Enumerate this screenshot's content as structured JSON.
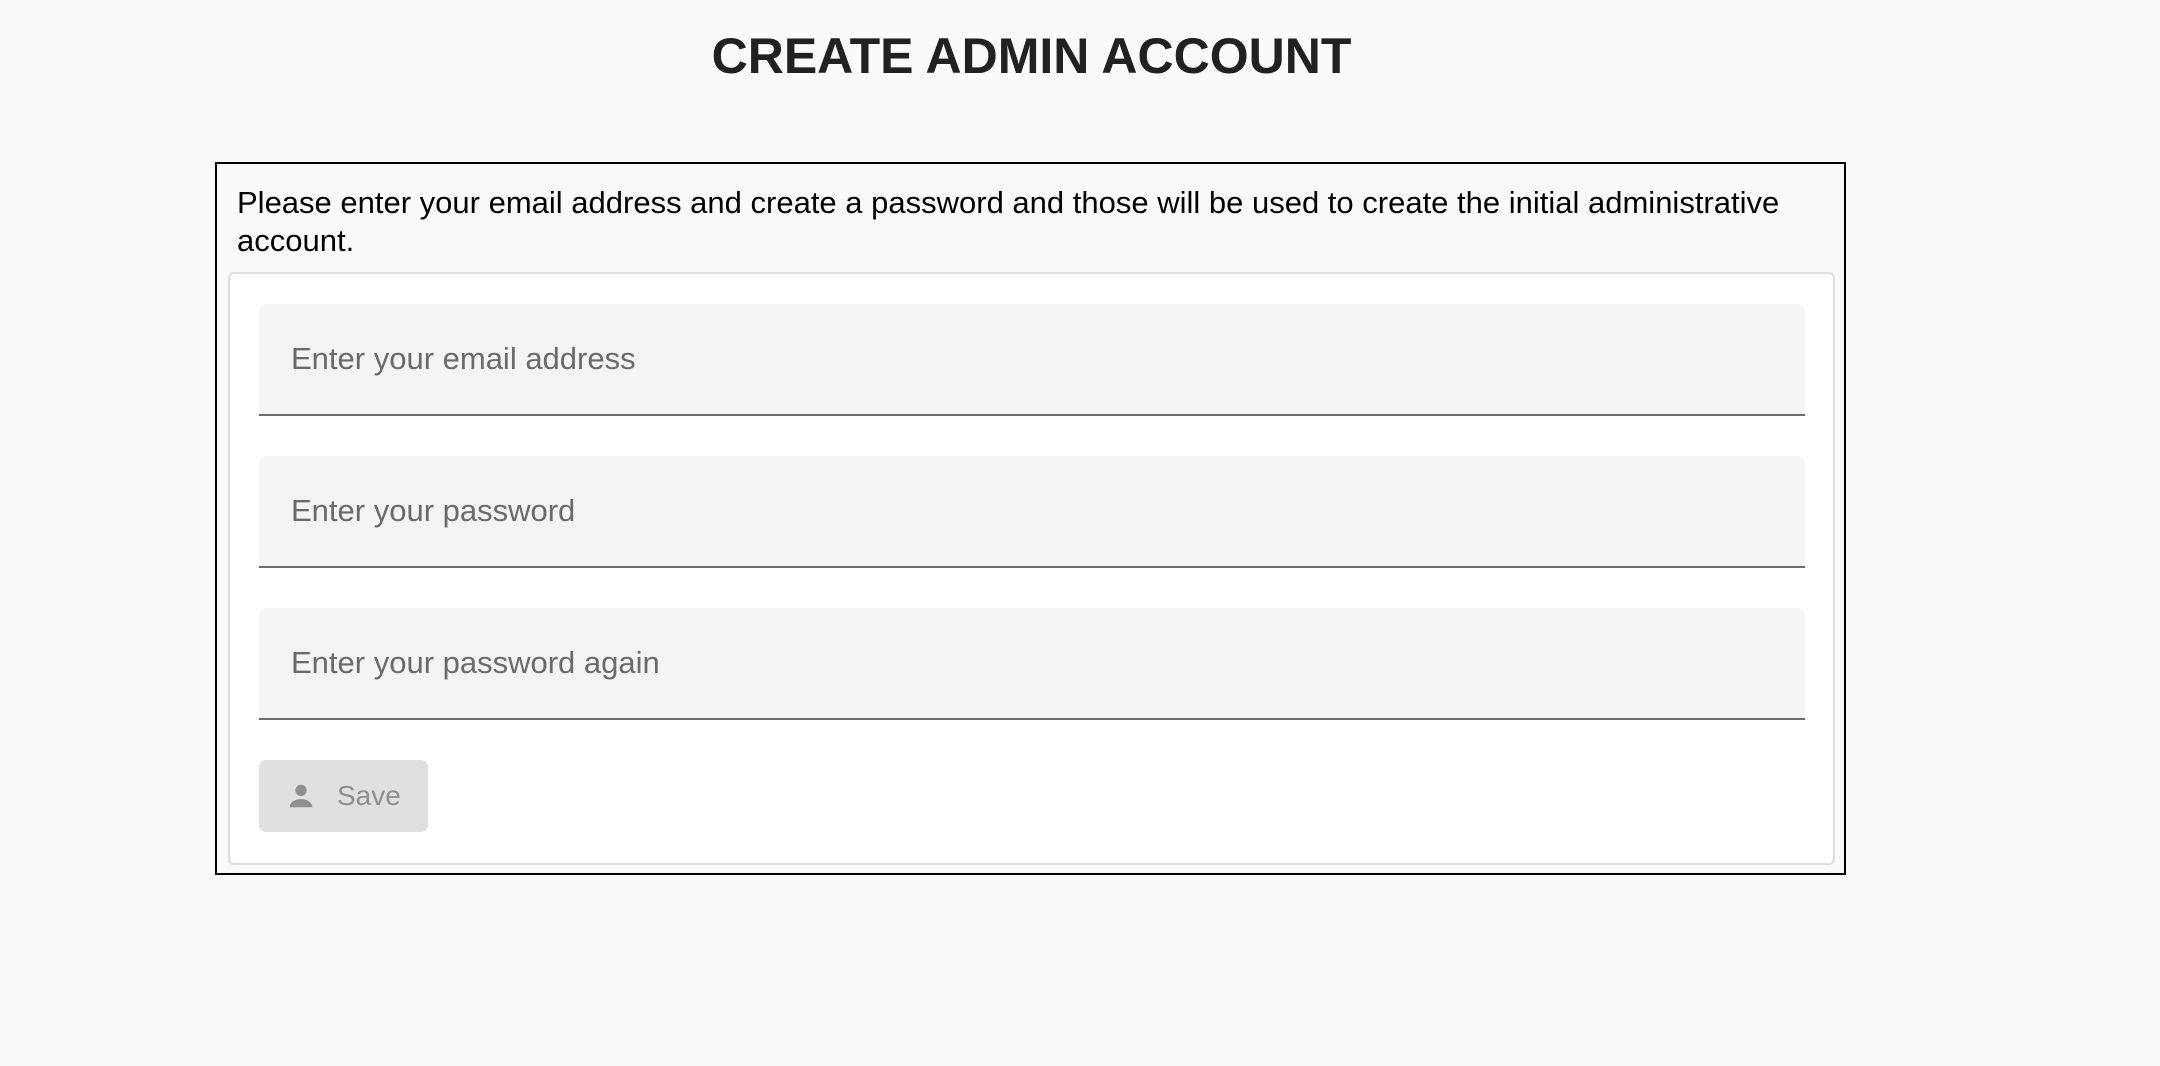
{
  "page": {
    "title": "CREATE ADMIN ACCOUNT"
  },
  "form": {
    "intro": "Please enter your email address and create a password and those will be used to create the initial administrative account.",
    "email": {
      "value": "",
      "placeholder": "Enter your email address"
    },
    "password": {
      "value": "",
      "placeholder": "Enter your password"
    },
    "password_again": {
      "value": "",
      "placeholder": "Enter your password again"
    },
    "save_button": {
      "label": "Save",
      "icon": "person-icon",
      "disabled": true
    }
  },
  "colors": {
    "background": "#fafafa",
    "field_fill": "#f4f4f4",
    "field_underline": "#6b6b6b",
    "button_disabled_fill": "#e0e0e0",
    "button_disabled_text": "#8f8f8f"
  }
}
